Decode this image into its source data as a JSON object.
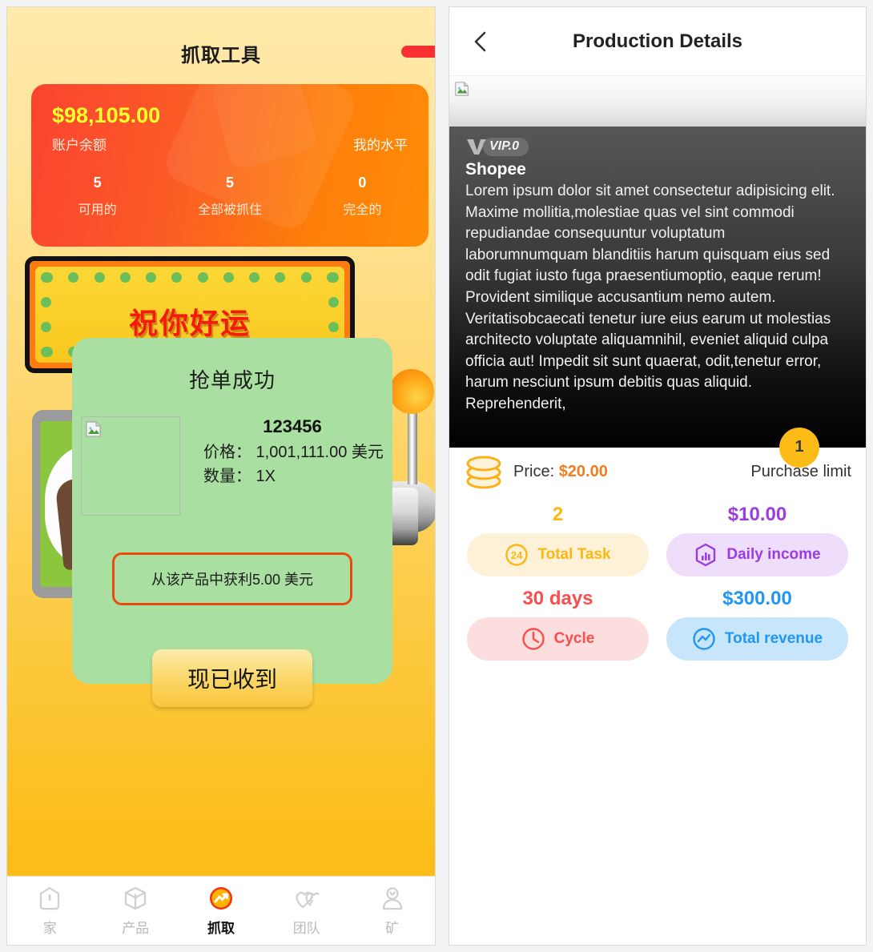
{
  "left": {
    "title": "抓取工具",
    "balance": {
      "amount": "$98,105.00",
      "amount_label": "账户余额",
      "level_label": "我的水平",
      "stats": [
        {
          "num": "5",
          "caption": "可用的"
        },
        {
          "num": "5",
          "caption": "全部被抓住"
        },
        {
          "num": "0",
          "caption": "完全的"
        }
      ]
    },
    "claw": {
      "luck_text": "祝你好运"
    },
    "modal": {
      "title": "抢单成功",
      "code": "123456",
      "price_line": "价格： 1,001,111.00 美元",
      "qty_line": "数量： 1X",
      "profit_text": "从该产品中获利5.00 美元",
      "button_label": "现已收到"
    },
    "nav": [
      {
        "label": "家",
        "icon": "home-icon",
        "active": false
      },
      {
        "label": "产品",
        "icon": "box-icon",
        "active": false
      },
      {
        "label": "抓取",
        "icon": "grab-icon",
        "active": true
      },
      {
        "label": "团队",
        "icon": "team-heart-icon",
        "active": false
      },
      {
        "label": "矿",
        "icon": "mine-user-icon",
        "active": false
      }
    ]
  },
  "right": {
    "header": {
      "title": "Production Details",
      "back_icon": "chevron-left-icon"
    },
    "vip": {
      "badge_text": "VIP.0",
      "logo_icon": "vip-v-icon"
    },
    "shop_name": "Shopee",
    "description": "Lorem ipsum dolor sit amet consectetur adipisicing elit. Maxime mollitia,molestiae quas vel sint commodi repudiandae consequuntur voluptatum laborumnumquam blanditiis harum quisquam eius sed odit fugiat iusto fuga praesentiumoptio, eaque rerum! Provident similique accusantium nemo autem. Veritatisobcaecati tenetur iure eius earum ut molestias architecto voluptate aliquamnihil, eveniet aliquid culpa officia aut! Impedit sit sunt quaerat, odit,tenetur error, harum nesciunt ipsum debitis quas aliquid. Reprehenderit,",
    "limit_badge": "1",
    "price": {
      "label": "Price:",
      "value": "$20.00",
      "icon": "coin-stack-icon"
    },
    "purchase_limit_label": "Purchase limit",
    "stats": [
      {
        "value": "2",
        "label": "Total Task",
        "icon": "task-24-icon",
        "color": "#fcb712",
        "bg": "#fdf1d7"
      },
      {
        "value": "$10.00",
        "label": "Daily income",
        "icon": "bar-chart-hex-icon",
        "color": "#9b3ce0",
        "bg": "#eeddfb"
      },
      {
        "value": "30 days",
        "label": "Cycle",
        "icon": "clock-icon",
        "color": "#fb4d4d",
        "bg": "#fcdede"
      },
      {
        "value": "$300.00",
        "label": "Total revenue",
        "icon": "trend-circle-icon",
        "color": "#2196f3",
        "bg": "#c7e6fb"
      }
    ]
  }
}
